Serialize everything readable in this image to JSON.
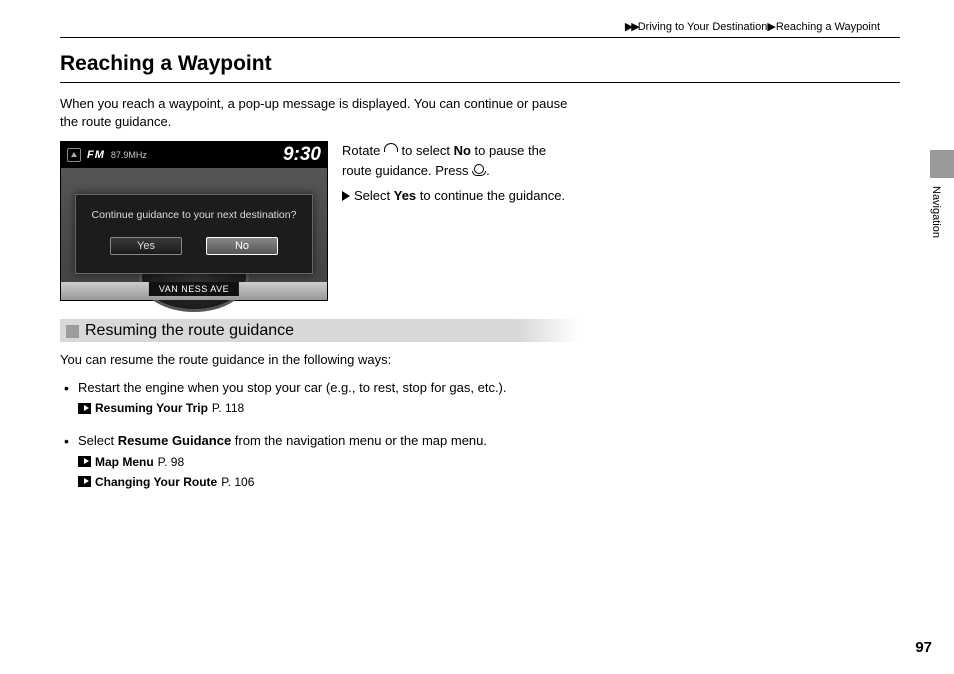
{
  "breadcrumb": {
    "arrows": "▶▶",
    "level1": "Driving to Your Destination",
    "sep": "▶",
    "level2": "Reaching a Waypoint"
  },
  "title": "Reaching a Waypoint",
  "intro": "When you reach a waypoint, a pop-up message is displayed. You can continue or pause the route guidance.",
  "screenshot": {
    "radio_band": "FM",
    "radio_freq_text": "87.9MHz",
    "clock": "9:30",
    "dialog_message": "Continue guidance to your next destination?",
    "btn_yes": "Yes",
    "btn_no": "No",
    "street": "VAN NESS AVE"
  },
  "instructions": {
    "line1a": "Rotate ",
    "line1b": " to select ",
    "no": "No",
    "line1c": " to pause the route guidance. Press ",
    "line1d": ".",
    "line2a": "Select ",
    "yes": "Yes",
    "line2b": " to continue the guidance."
  },
  "subhead": "Resuming the route guidance",
  "resume_intro": "You can resume the route guidance in the following ways:",
  "bullets": [
    {
      "text": "Restart the engine when you stop your car (e.g., to rest, stop for gas, etc.).",
      "xrefs": [
        {
          "label": "Resuming Your Trip",
          "page": "P. 118"
        }
      ]
    },
    {
      "text_a": "Select ",
      "bold": "Resume Guidance",
      "text_b": " from the navigation menu or the map menu.",
      "xrefs": [
        {
          "label": "Map Menu",
          "page": "P. 98"
        },
        {
          "label": "Changing Your Route",
          "page": "P. 106"
        }
      ]
    }
  ],
  "side_tab": "Navigation",
  "page_number": "97"
}
